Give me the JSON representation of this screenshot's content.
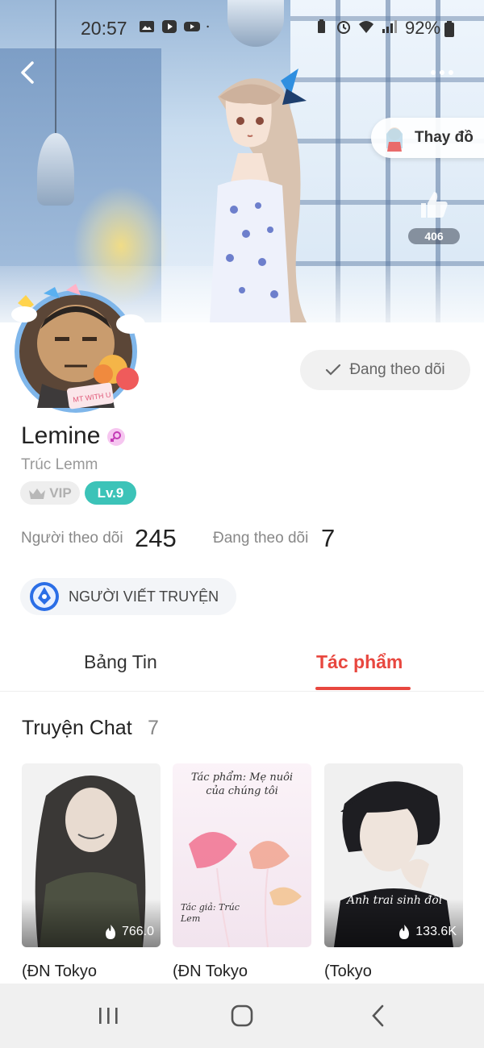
{
  "status_bar": {
    "time": "20:57",
    "battery": "92%"
  },
  "header": {
    "change_outfit_label": "Thay đồ",
    "like_count": "406"
  },
  "profile": {
    "follow_button_label": "Đang theo dõi",
    "username": "Lemine",
    "handle": "Trúc Lemm",
    "vip_label": "VIP",
    "level_label": "Lv.9",
    "avatar_sticker_text": "MT WITH U",
    "followers_label": "Người theo dõi",
    "followers_count": "245",
    "following_label": "Đang theo dõi",
    "following_count": "7",
    "writer_tag": "NGƯỜI VIẾT TRUYỆN"
  },
  "tabs": [
    {
      "label": "Bảng Tin",
      "active": false
    },
    {
      "label": "Tác phẩm",
      "active": true
    }
  ],
  "section": {
    "title": "Truyện Chat",
    "count": "7"
  },
  "stories": [
    {
      "title": "(ĐN Tokyo",
      "views": "766.0",
      "cover_text": ""
    },
    {
      "title": "(ĐN Tokyo",
      "views": "",
      "cover_text": "Tác phẩm: Mẹ nuôi của chúng tôi",
      "cover_author": "Tác giả: Trúc Lem"
    },
    {
      "title": "(Tokyo",
      "views": "133.6K",
      "cover_text": "Anh trai sinh đôi"
    }
  ],
  "colors": {
    "accent": "#e8473f",
    "level": "#3cc3b8"
  },
  "icons": [
    "back-icon",
    "more-icon",
    "like-icon",
    "gender-female-icon",
    "crown-icon",
    "check-icon",
    "pen-icon",
    "fire-icon",
    "recents-icon",
    "home-icon",
    "back-nav-icon"
  ]
}
